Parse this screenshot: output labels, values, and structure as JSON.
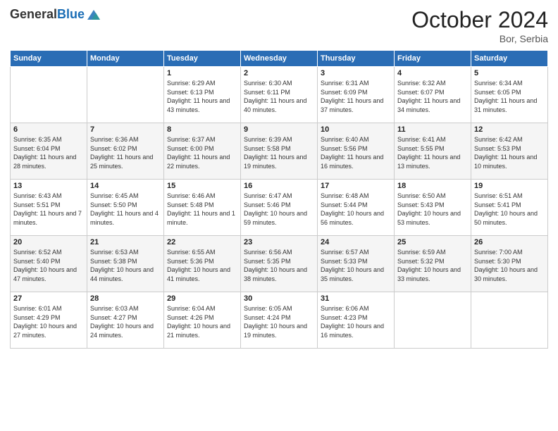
{
  "header": {
    "logo_general": "General",
    "logo_blue": "Blue",
    "month": "October 2024",
    "location": "Bor, Serbia"
  },
  "days_of_week": [
    "Sunday",
    "Monday",
    "Tuesday",
    "Wednesday",
    "Thursday",
    "Friday",
    "Saturday"
  ],
  "weeks": [
    [
      {
        "day": "",
        "info": ""
      },
      {
        "day": "",
        "info": ""
      },
      {
        "day": "1",
        "sunrise": "Sunrise: 6:29 AM",
        "sunset": "Sunset: 6:13 PM",
        "daylight": "Daylight: 11 hours and 43 minutes."
      },
      {
        "day": "2",
        "sunrise": "Sunrise: 6:30 AM",
        "sunset": "Sunset: 6:11 PM",
        "daylight": "Daylight: 11 hours and 40 minutes."
      },
      {
        "day": "3",
        "sunrise": "Sunrise: 6:31 AM",
        "sunset": "Sunset: 6:09 PM",
        "daylight": "Daylight: 11 hours and 37 minutes."
      },
      {
        "day": "4",
        "sunrise": "Sunrise: 6:32 AM",
        "sunset": "Sunset: 6:07 PM",
        "daylight": "Daylight: 11 hours and 34 minutes."
      },
      {
        "day": "5",
        "sunrise": "Sunrise: 6:34 AM",
        "sunset": "Sunset: 6:05 PM",
        "daylight": "Daylight: 11 hours and 31 minutes."
      }
    ],
    [
      {
        "day": "6",
        "sunrise": "Sunrise: 6:35 AM",
        "sunset": "Sunset: 6:04 PM",
        "daylight": "Daylight: 11 hours and 28 minutes."
      },
      {
        "day": "7",
        "sunrise": "Sunrise: 6:36 AM",
        "sunset": "Sunset: 6:02 PM",
        "daylight": "Daylight: 11 hours and 25 minutes."
      },
      {
        "day": "8",
        "sunrise": "Sunrise: 6:37 AM",
        "sunset": "Sunset: 6:00 PM",
        "daylight": "Daylight: 11 hours and 22 minutes."
      },
      {
        "day": "9",
        "sunrise": "Sunrise: 6:39 AM",
        "sunset": "Sunset: 5:58 PM",
        "daylight": "Daylight: 11 hours and 19 minutes."
      },
      {
        "day": "10",
        "sunrise": "Sunrise: 6:40 AM",
        "sunset": "Sunset: 5:56 PM",
        "daylight": "Daylight: 11 hours and 16 minutes."
      },
      {
        "day": "11",
        "sunrise": "Sunrise: 6:41 AM",
        "sunset": "Sunset: 5:55 PM",
        "daylight": "Daylight: 11 hours and 13 minutes."
      },
      {
        "day": "12",
        "sunrise": "Sunrise: 6:42 AM",
        "sunset": "Sunset: 5:53 PM",
        "daylight": "Daylight: 11 hours and 10 minutes."
      }
    ],
    [
      {
        "day": "13",
        "sunrise": "Sunrise: 6:43 AM",
        "sunset": "Sunset: 5:51 PM",
        "daylight": "Daylight: 11 hours and 7 minutes."
      },
      {
        "day": "14",
        "sunrise": "Sunrise: 6:45 AM",
        "sunset": "Sunset: 5:50 PM",
        "daylight": "Daylight: 11 hours and 4 minutes."
      },
      {
        "day": "15",
        "sunrise": "Sunrise: 6:46 AM",
        "sunset": "Sunset: 5:48 PM",
        "daylight": "Daylight: 11 hours and 1 minute."
      },
      {
        "day": "16",
        "sunrise": "Sunrise: 6:47 AM",
        "sunset": "Sunset: 5:46 PM",
        "daylight": "Daylight: 10 hours and 59 minutes."
      },
      {
        "day": "17",
        "sunrise": "Sunrise: 6:48 AM",
        "sunset": "Sunset: 5:44 PM",
        "daylight": "Daylight: 10 hours and 56 minutes."
      },
      {
        "day": "18",
        "sunrise": "Sunrise: 6:50 AM",
        "sunset": "Sunset: 5:43 PM",
        "daylight": "Daylight: 10 hours and 53 minutes."
      },
      {
        "day": "19",
        "sunrise": "Sunrise: 6:51 AM",
        "sunset": "Sunset: 5:41 PM",
        "daylight": "Daylight: 10 hours and 50 minutes."
      }
    ],
    [
      {
        "day": "20",
        "sunrise": "Sunrise: 6:52 AM",
        "sunset": "Sunset: 5:40 PM",
        "daylight": "Daylight: 10 hours and 47 minutes."
      },
      {
        "day": "21",
        "sunrise": "Sunrise: 6:53 AM",
        "sunset": "Sunset: 5:38 PM",
        "daylight": "Daylight: 10 hours and 44 minutes."
      },
      {
        "day": "22",
        "sunrise": "Sunrise: 6:55 AM",
        "sunset": "Sunset: 5:36 PM",
        "daylight": "Daylight: 10 hours and 41 minutes."
      },
      {
        "day": "23",
        "sunrise": "Sunrise: 6:56 AM",
        "sunset": "Sunset: 5:35 PM",
        "daylight": "Daylight: 10 hours and 38 minutes."
      },
      {
        "day": "24",
        "sunrise": "Sunrise: 6:57 AM",
        "sunset": "Sunset: 5:33 PM",
        "daylight": "Daylight: 10 hours and 35 minutes."
      },
      {
        "day": "25",
        "sunrise": "Sunrise: 6:59 AM",
        "sunset": "Sunset: 5:32 PM",
        "daylight": "Daylight: 10 hours and 33 minutes."
      },
      {
        "day": "26",
        "sunrise": "Sunrise: 7:00 AM",
        "sunset": "Sunset: 5:30 PM",
        "daylight": "Daylight: 10 hours and 30 minutes."
      }
    ],
    [
      {
        "day": "27",
        "sunrise": "Sunrise: 6:01 AM",
        "sunset": "Sunset: 4:29 PM",
        "daylight": "Daylight: 10 hours and 27 minutes."
      },
      {
        "day": "28",
        "sunrise": "Sunrise: 6:03 AM",
        "sunset": "Sunset: 4:27 PM",
        "daylight": "Daylight: 10 hours and 24 minutes."
      },
      {
        "day": "29",
        "sunrise": "Sunrise: 6:04 AM",
        "sunset": "Sunset: 4:26 PM",
        "daylight": "Daylight: 10 hours and 21 minutes."
      },
      {
        "day": "30",
        "sunrise": "Sunrise: 6:05 AM",
        "sunset": "Sunset: 4:24 PM",
        "daylight": "Daylight: 10 hours and 19 minutes."
      },
      {
        "day": "31",
        "sunrise": "Sunrise: 6:06 AM",
        "sunset": "Sunset: 4:23 PM",
        "daylight": "Daylight: 10 hours and 16 minutes."
      },
      {
        "day": "",
        "info": ""
      },
      {
        "day": "",
        "info": ""
      }
    ]
  ]
}
